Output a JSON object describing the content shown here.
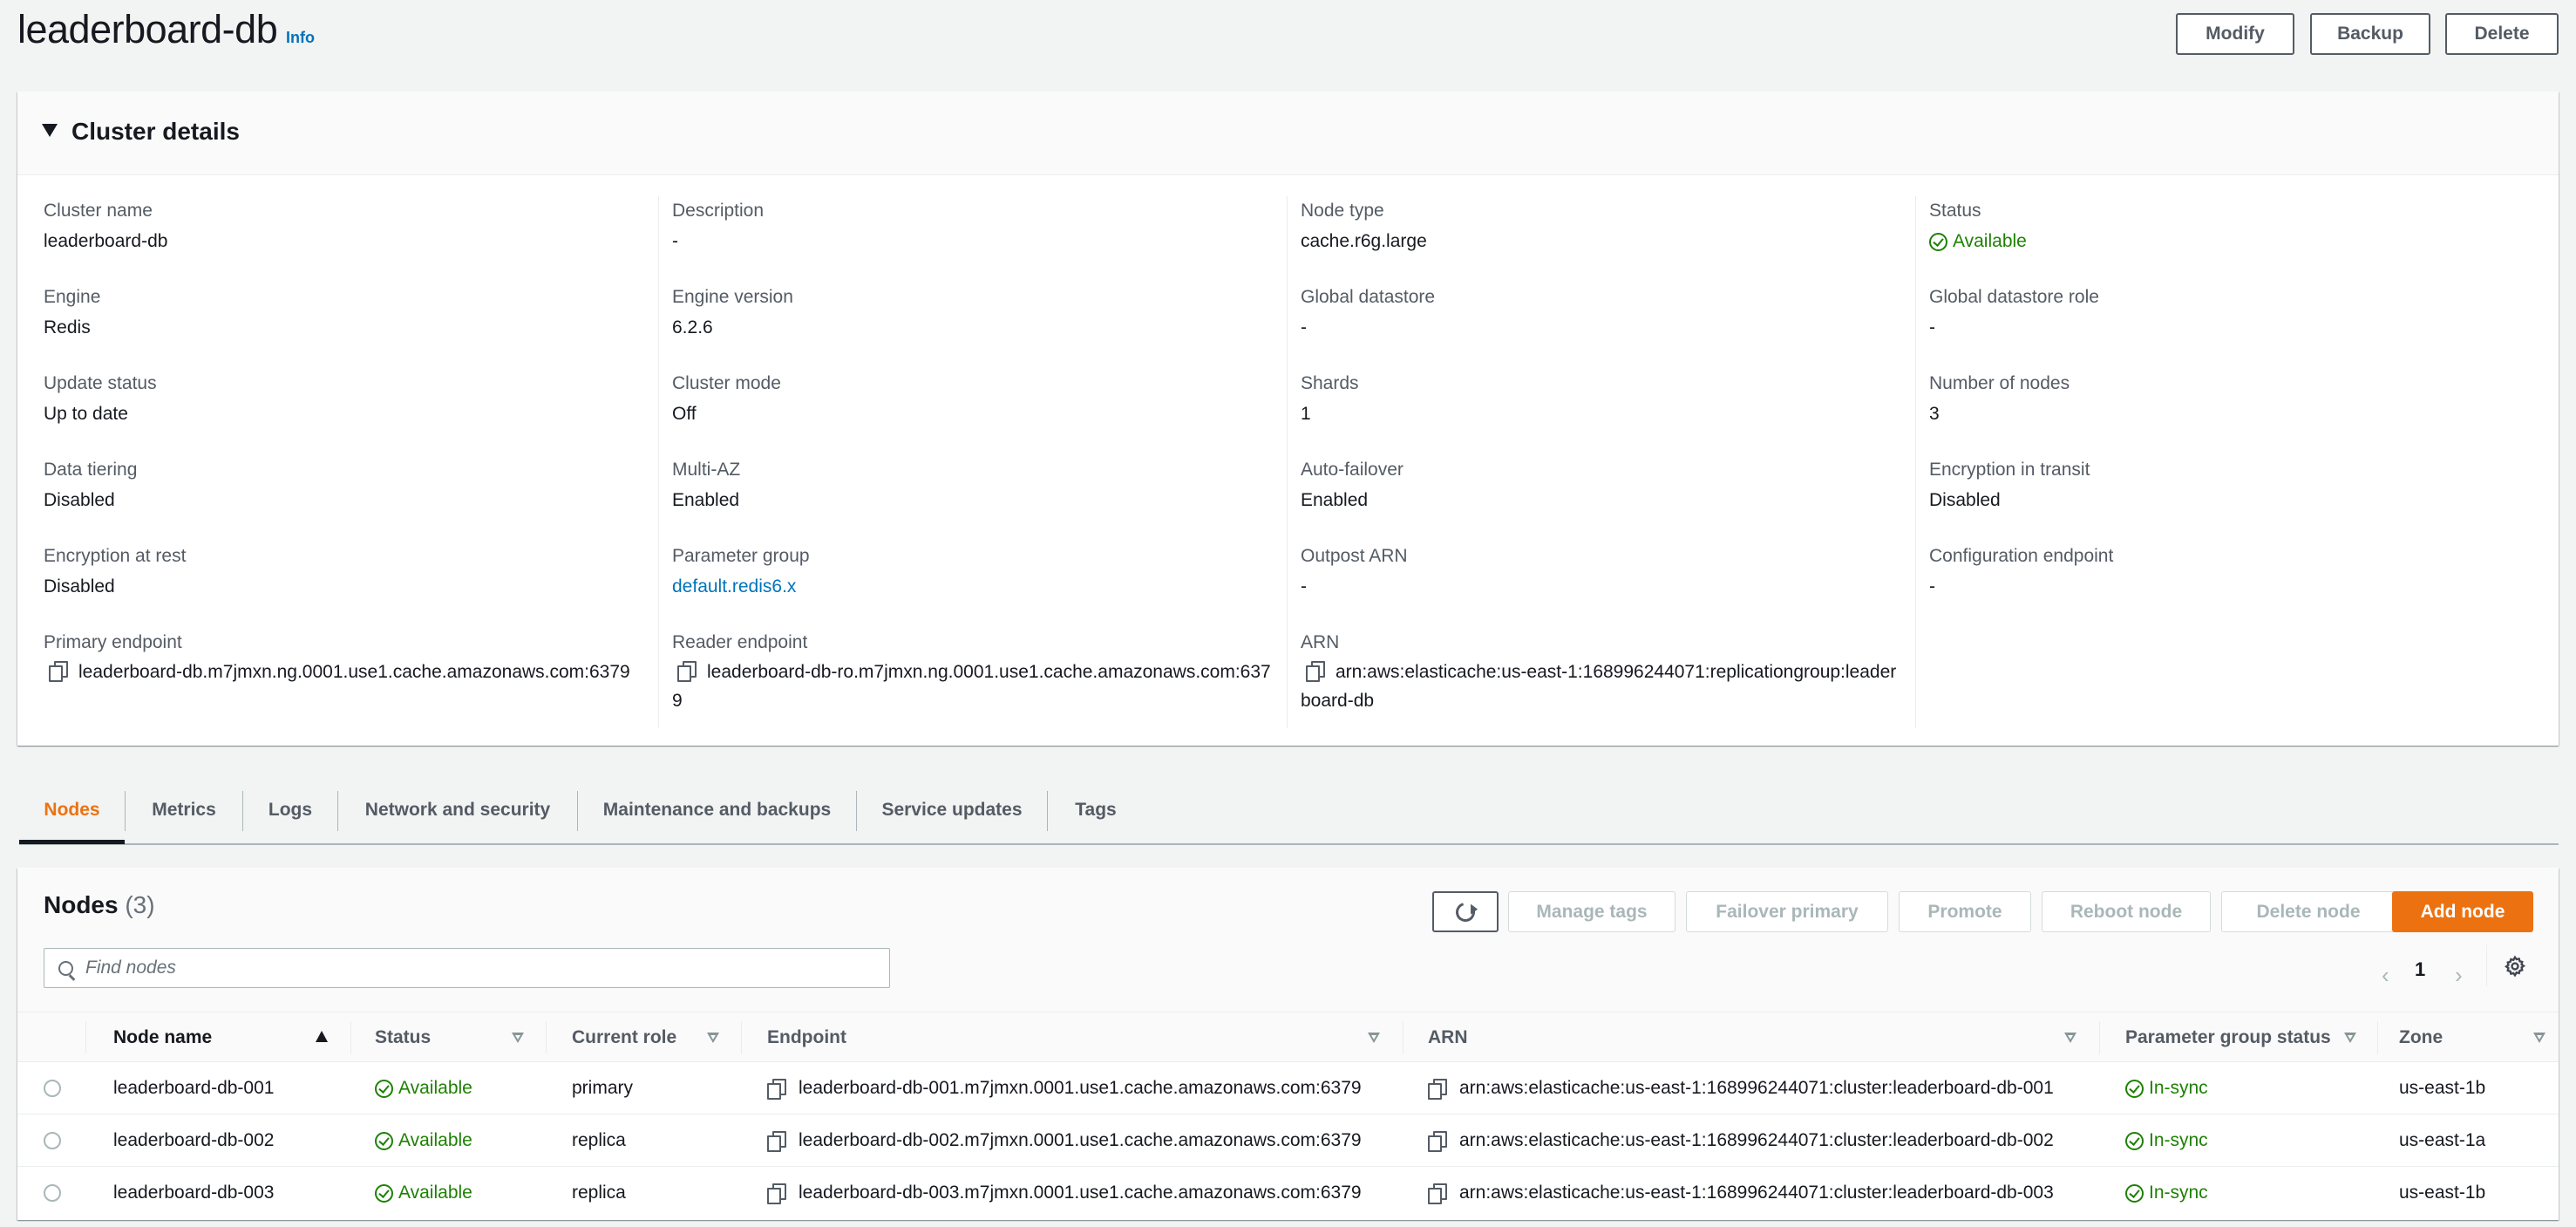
{
  "header": {
    "title": "leaderboard-db",
    "info_label": "Info",
    "buttons": {
      "modify": "Modify",
      "backup": "Backup",
      "delete": "Delete"
    }
  },
  "cluster_details": {
    "title": "Cluster details",
    "columns": [
      [
        {
          "label": "Cluster name",
          "value": "leaderboard-db"
        },
        {
          "label": "Engine",
          "value": "Redis"
        },
        {
          "label": "Update status",
          "value": "Up to date"
        },
        {
          "label": "Data tiering",
          "value": "Disabled"
        },
        {
          "label": "Encryption at rest",
          "value": "Disabled"
        },
        {
          "label": "Primary endpoint",
          "value": "leaderboard-db.m7jmxn.ng.0001.use1.cache.amazonaws.com:6379",
          "icon": "copy-icon"
        }
      ],
      [
        {
          "label": "Description",
          "value": "-"
        },
        {
          "label": "Engine version",
          "value": "6.2.6"
        },
        {
          "label": "Cluster mode",
          "value": "Off"
        },
        {
          "label": "Multi-AZ",
          "value": "Enabled"
        },
        {
          "label": "Parameter group",
          "value": "default.redis6.x",
          "link": true
        },
        {
          "label": "Reader endpoint",
          "value": "leaderboard-db-ro.m7jmxn.ng.0001.use1.cache.amazonaws.com:6379",
          "icon": "copy-icon"
        }
      ],
      [
        {
          "label": "Node type",
          "value": "cache.r6g.large"
        },
        {
          "label": "Global datastore",
          "value": "-"
        },
        {
          "label": "Shards",
          "value": "1"
        },
        {
          "label": "Auto-failover",
          "value": "Enabled"
        },
        {
          "label": "Outpost ARN",
          "value": "-"
        },
        {
          "label": "ARN",
          "value": "arn:aws:elasticache:us-east-1:168996244071:replicationgroup:leaderboard-db",
          "icon": "copy-icon"
        }
      ],
      [
        {
          "label": "Status",
          "value": "Available",
          "status": "success"
        },
        {
          "label": "Global datastore role",
          "value": "-"
        },
        {
          "label": "Number of nodes",
          "value": "3"
        },
        {
          "label": "Encryption in transit",
          "value": "Disabled"
        },
        {
          "label": "Configuration endpoint",
          "value": "-"
        }
      ]
    ]
  },
  "tabs": [
    {
      "label": "Nodes",
      "active": true
    },
    {
      "label": "Metrics"
    },
    {
      "label": "Logs"
    },
    {
      "label": "Network and security"
    },
    {
      "label": "Maintenance and backups"
    },
    {
      "label": "Service updates"
    },
    {
      "label": "Tags"
    }
  ],
  "nodes": {
    "title": "Nodes",
    "count": "(3)",
    "actions": {
      "manage_tags": "Manage tags",
      "failover_primary": "Failover primary",
      "promote": "Promote",
      "reboot_node": "Reboot node",
      "delete_node": "Delete node",
      "add_node": "Add node"
    },
    "search": {
      "placeholder": "Find nodes",
      "value": ""
    },
    "pagination": {
      "current_page": "1"
    },
    "columns": [
      "Node name",
      "Status",
      "Current role",
      "Endpoint",
      "ARN",
      "Parameter group status",
      "Zone"
    ],
    "sorted_column": "Node name",
    "rows": [
      {
        "name": "leaderboard-db-001",
        "status": "Available",
        "role": "primary",
        "endpoint": "leaderboard-db-001.m7jmxn.0001.use1.cache.amazonaws.com:6379",
        "arn": "arn:aws:elasticache:us-east-1:168996244071:cluster:leaderboard-db-001",
        "param_status": "In-sync",
        "zone": "us-east-1b"
      },
      {
        "name": "leaderboard-db-002",
        "status": "Available",
        "role": "replica",
        "endpoint": "leaderboard-db-002.m7jmxn.0001.use1.cache.amazonaws.com:6379",
        "arn": "arn:aws:elasticache:us-east-1:168996244071:cluster:leaderboard-db-002",
        "param_status": "In-sync",
        "zone": "us-east-1a"
      },
      {
        "name": "leaderboard-db-003",
        "status": "Available",
        "role": "replica",
        "endpoint": "leaderboard-db-003.m7jmxn.0001.use1.cache.amazonaws.com:6379",
        "arn": "arn:aws:elasticache:us-east-1:168996244071:cluster:leaderboard-db-003",
        "param_status": "In-sync",
        "zone": "us-east-1b"
      }
    ]
  },
  "colors": {
    "accent": "#ec7211",
    "link": "#0073bb",
    "success": "#1d8102",
    "text": "#16191f",
    "muted": "#545b64",
    "background": "#f2f3f3"
  }
}
